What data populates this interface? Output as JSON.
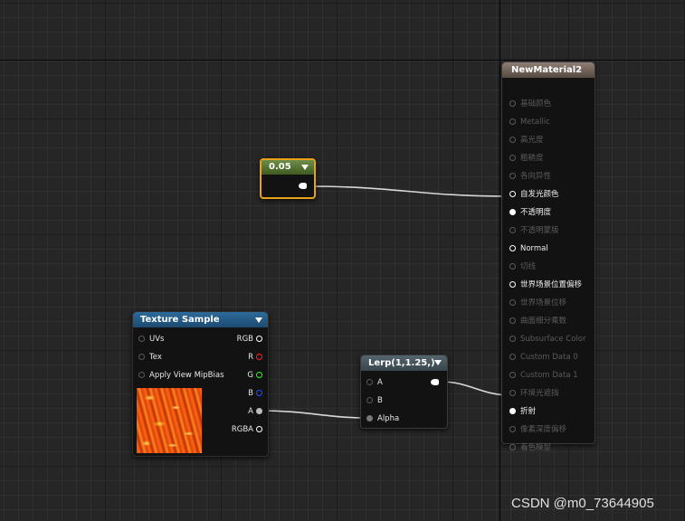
{
  "material_node": {
    "title": "NewMaterial2",
    "pins": [
      {
        "label": "基础颜色",
        "active": false,
        "connected": false
      },
      {
        "label": "Metallic",
        "active": false,
        "connected": false
      },
      {
        "label": "高光度",
        "active": false,
        "connected": false
      },
      {
        "label": "粗糙度",
        "active": false,
        "connected": false
      },
      {
        "label": "各向异性",
        "active": false,
        "connected": false
      },
      {
        "label": "自发光颜色",
        "active": true,
        "connected": false
      },
      {
        "label": "不透明度",
        "active": true,
        "connected": true
      },
      {
        "label": "不透明蒙版",
        "active": false,
        "connected": false
      },
      {
        "label": "Normal",
        "active": true,
        "connected": false
      },
      {
        "label": "切线",
        "active": false,
        "connected": false
      },
      {
        "label": "世界场景位置偏移",
        "active": true,
        "connected": false
      },
      {
        "label": "世界场景位移",
        "active": false,
        "connected": false
      },
      {
        "label": "曲面细分乘数",
        "active": false,
        "connected": false
      },
      {
        "label": "Subsurface Color",
        "active": false,
        "connected": false
      },
      {
        "label": "Custom Data 0",
        "active": false,
        "connected": false
      },
      {
        "label": "Custom Data 1",
        "active": false,
        "connected": false
      },
      {
        "label": "环境光遮挡",
        "active": false,
        "connected": false
      },
      {
        "label": "折射",
        "active": true,
        "connected": true
      },
      {
        "label": "像素深度偏移",
        "active": false,
        "connected": false
      },
      {
        "label": "着色模型",
        "active": false,
        "connected": false
      }
    ]
  },
  "constant_node": {
    "value": "0.05"
  },
  "texture_node": {
    "title": "Texture Sample",
    "inputs": [
      "UVs",
      "Tex",
      "Apply View MipBias"
    ],
    "outputs": [
      {
        "label": "RGB",
        "color": "#ffffff"
      },
      {
        "label": "R",
        "color": "#ff2020"
      },
      {
        "label": "G",
        "color": "#20ff20"
      },
      {
        "label": "B",
        "color": "#2050ff"
      },
      {
        "label": "A",
        "color": "#bbbbbb"
      },
      {
        "label": "RGBA",
        "color": "#ffffff"
      }
    ]
  },
  "lerp_node": {
    "title": "Lerp(1,1.25,)",
    "inputs": [
      "A",
      "B",
      "Alpha"
    ]
  },
  "watermark": "CSDN @m0_73644905"
}
